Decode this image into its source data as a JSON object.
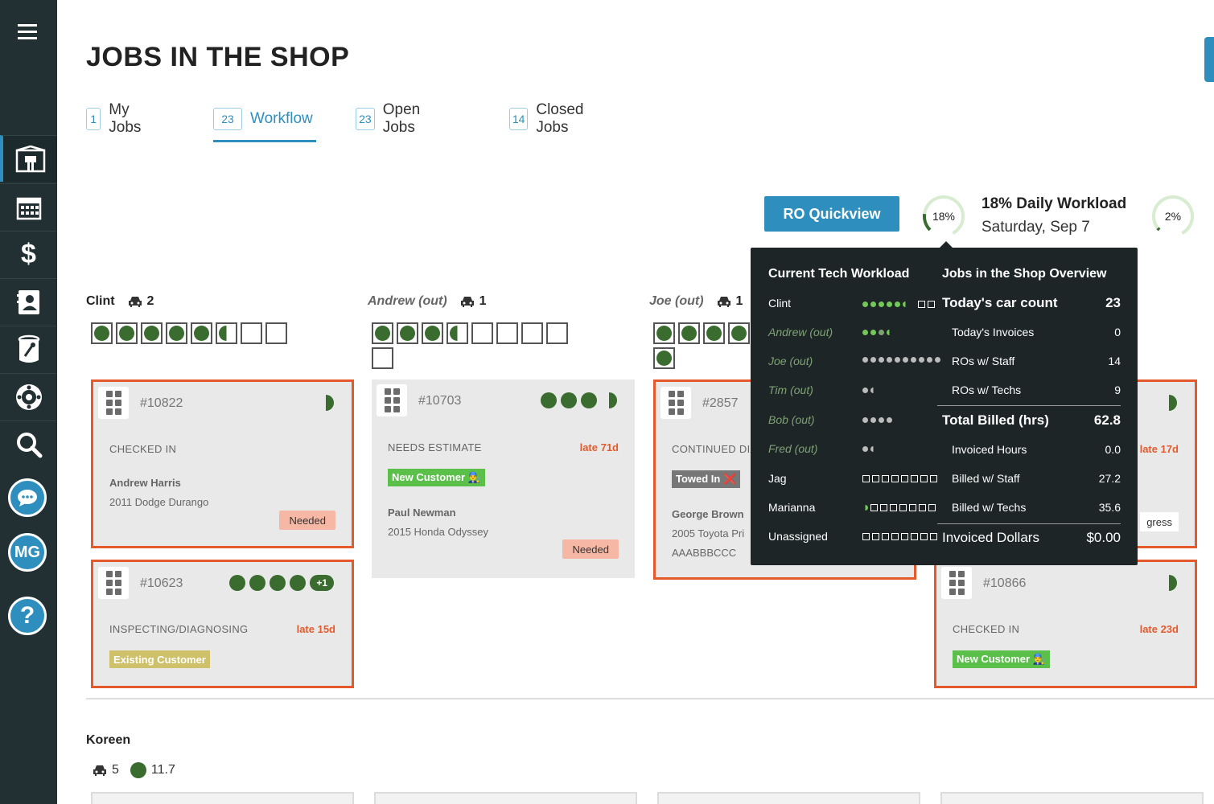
{
  "sidebar": {
    "menu_icon": "hamburger-icon",
    "items": [
      {
        "name": "shop-icon"
      },
      {
        "name": "calendar-icon"
      },
      {
        "name": "dollar-icon"
      },
      {
        "name": "contacts-icon"
      },
      {
        "name": "parts-icon"
      },
      {
        "name": "tire-icon"
      },
      {
        "name": "search-icon"
      }
    ],
    "avatar_initials": "MG",
    "help_label": "?"
  },
  "page": {
    "title": "JOBS IN THE SHOP"
  },
  "tabs": [
    {
      "count": "1",
      "label": "My Jobs"
    },
    {
      "count": "23",
      "label": "Workflow",
      "active": true
    },
    {
      "count": "23",
      "label": "Open Jobs"
    },
    {
      "count": "14",
      "label": "Closed Jobs"
    }
  ],
  "ro_quickview": {
    "label": "RO Quickview"
  },
  "workload": {
    "gauge1": "18%",
    "gauge1_value": 0.18,
    "title": "18% Daily Workload",
    "date": "Saturday, Sep 7",
    "gauge2": "2%",
    "gauge2_value": 0.02
  },
  "columns": [
    {
      "tech": "Clint",
      "cars": "2"
    },
    {
      "tech": "Andrew (out)",
      "cars": "1"
    },
    {
      "tech": "Joe (out)",
      "cars": "1"
    }
  ],
  "cards": {
    "c1": {
      "num": "#10822",
      "status": "CHECKED IN",
      "name": "Andrew Harris",
      "vehicle": "2011 Dodge Durango",
      "needed": "Needed"
    },
    "c2": {
      "num": "#10623",
      "status": "INSPECTING/DIAGNOSING",
      "late": "late 15d",
      "badge": "Existing Customer",
      "plus": "+1"
    },
    "c3": {
      "num": "#10703",
      "status": "NEEDS ESTIMATE",
      "late": "late 71d",
      "badge": "New Customer 👨‍🔧",
      "name": "Paul Newman",
      "vehicle": "2015 Honda Odyssey",
      "needed": "Needed"
    },
    "c4": {
      "num": "#2857",
      "status": "CONTINUED DIA",
      "badge": "Towed In ❌",
      "name": "George Brown",
      "vehicle": "2005 Toyota Pri",
      "plate": "AAABBBCCC"
    },
    "c5": {
      "late": "late 17d",
      "partial": "gress"
    },
    "c6": {
      "num": "#10866",
      "status": "CHECKED IN",
      "late": "late 23d",
      "badge": "New Customer 👨‍🔧"
    }
  },
  "popup": {
    "left_title": "Current Tech Workload",
    "right_title": "Jobs in the Shop Overview",
    "techs": [
      {
        "name": "Clint",
        "out": false
      },
      {
        "name": "Andrew (out)",
        "out": true
      },
      {
        "name": "Joe (out)",
        "out": true
      },
      {
        "name": "Tim (out)",
        "out": true
      },
      {
        "name": "Bob (out)",
        "out": true
      },
      {
        "name": "Fred (out)",
        "out": true
      },
      {
        "name": "Jag",
        "out": false
      },
      {
        "name": "Marianna",
        "out": false
      },
      {
        "name": "Unassigned",
        "out": false
      }
    ],
    "overview": {
      "car_count_label": "Today's car count",
      "car_count": "23",
      "invoices_label": "Today's Invoices",
      "invoices": "0",
      "ros_staff_label": "ROs w/ Staff",
      "ros_staff": "14",
      "ros_techs_label": "ROs w/ Techs",
      "ros_techs": "9",
      "billed_label": "Total Billed (hrs)",
      "billed": "62.8",
      "inv_hours_label": "Invoiced Hours",
      "inv_hours": "0.0",
      "billed_staff_label": "Billed w/ Staff",
      "billed_staff": "27.2",
      "billed_techs_label": "Billed w/ Techs",
      "billed_techs": "35.6",
      "inv_dollars_label": "Invoiced Dollars",
      "inv_dollars": "$0.00"
    }
  },
  "koreen": {
    "name": "Koreen",
    "cars": "5",
    "hours": "11.7"
  }
}
